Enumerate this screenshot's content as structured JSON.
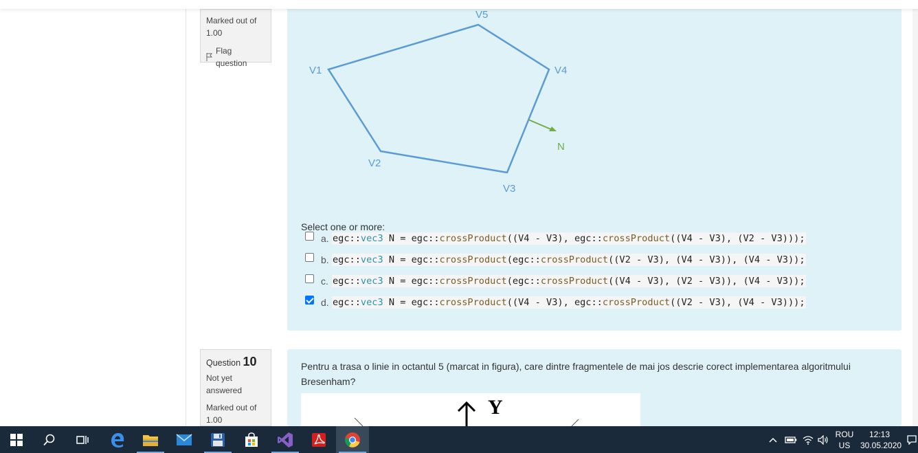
{
  "q9": {
    "marked_out_of": "Marked out of",
    "marked_value": "1.00",
    "flag_label": "Flag question",
    "figure_labels": {
      "v1": "V1",
      "v2": "V2",
      "v3": "V3",
      "v4": "V4",
      "v5": "V5",
      "n": "N"
    },
    "prompt": "Select one or more:",
    "answers": [
      {
        "letter": "a.",
        "checked": false
      },
      {
        "letter": "b.",
        "checked": false
      },
      {
        "letter": "c.",
        "checked": false
      },
      {
        "letter": "d.",
        "checked": true
      }
    ],
    "code": {
      "ns": "egc::",
      "type": "vec3",
      "a": {
        "pre": " N = egc::",
        "f1": "crossProduct",
        "mid": "((V4 - V3), egc::",
        "f2": "crossProduct",
        "post": "((V4 - V3), (V2 - V3)));"
      },
      "b": {
        "pre": " N = egc::",
        "f1": "crossProduct",
        "mid": "(egc::",
        "f2": "crossProduct",
        "post": "((V2 - V3), (V4 - V3)), (V4 - V3));"
      },
      "c": {
        "pre": " N = egc::",
        "f1": "crossProduct",
        "mid": "(egc::",
        "f2": "crossProduct",
        "post": "((V4 - V3), (V2 - V3)), (V4 - V3));"
      },
      "d": {
        "pre": " N = egc::",
        "f1": "crossProduct",
        "mid": "((V4 - V3), egc::",
        "f2": "crossProduct",
        "post": "((V2 - V3), (V4 - V3)));"
      }
    }
  },
  "q10": {
    "question_label": "Question",
    "number": "10",
    "status": "Not yet answered",
    "marked_out_of": "Marked out of",
    "marked_value": "1.00",
    "text": "Pentru a trasa o linie in octantul 5 (marcat in figura), care dintre fragmentele de mai jos descrie corect implementarea algoritmului Bresenham?",
    "figure_axis": "Y"
  },
  "taskbar": {
    "lang_top": "ROU",
    "lang_bottom": "US",
    "time": "12:13",
    "date": "30.05.2020",
    "colors": {
      "bg": "#1b2a3a",
      "active": "#38495a"
    }
  }
}
